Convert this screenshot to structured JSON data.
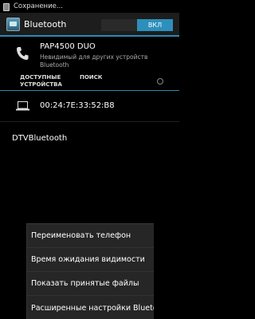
{
  "status_bar": {
    "text": "Сохранение...",
    "icon": "save-notification-icon"
  },
  "action_bar": {
    "title": "Bluetooth",
    "toggle_on_label": "ВКЛ",
    "app_icon": "bluetooth-settings-icon"
  },
  "device": {
    "name": "PAP4500 DUO",
    "subtitle": "Невидимый для других устройств Bluetooth",
    "icon": "phone-icon"
  },
  "sections": {
    "available_title": "ДОСТУПНЫЕ УСТРОЙСТВА",
    "search_label": "ПОИСК"
  },
  "paired": {
    "address": "00:24:7E:33:52:B8",
    "icon": "laptop-icon"
  },
  "available": {
    "name": "DTVBluetooth"
  },
  "menu": {
    "items": [
      {
        "label": "Переименовать телефон"
      },
      {
        "label": "Время ожидания видимости"
      },
      {
        "label": "Показать принятые файлы"
      },
      {
        "label": "Расширенные настройки Bluetooth"
      }
    ]
  },
  "colors": {
    "accent": "#2d8fbc",
    "background": "#000000"
  }
}
